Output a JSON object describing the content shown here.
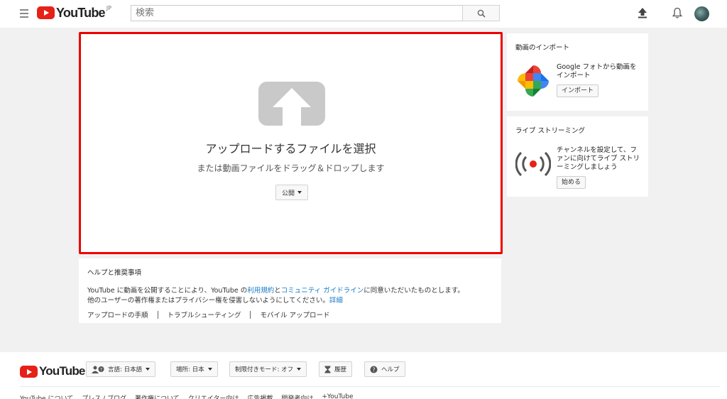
{
  "header": {
    "logo_text": "YouTube",
    "region": "JP",
    "search_placeholder": "検索"
  },
  "upload": {
    "title": "アップロードするファイルを選択",
    "subtitle": "または動画ファイルをドラッグ＆ドロップします",
    "privacy_label": "公開"
  },
  "help": {
    "title": "ヘルプと推奨事項",
    "text_1": "YouTube に動画を公開することにより、YouTube の",
    "link_terms": "利用規約",
    "text_2": "と",
    "link_guidelines": "コミュニティ ガイドライン",
    "text_3": "に同意いただいたものとします。",
    "text_4": "他のユーザーの著作権またはプライバシー権を侵害しないようにしてください。",
    "link_details": "詳細",
    "links": [
      "アップロードの手順",
      "トラブルシューティング",
      "モバイル アップロード"
    ]
  },
  "sidebar": {
    "import": {
      "title": "動画のインポート",
      "body": "Google フォトから動画をインポート",
      "button": "インポート"
    },
    "live": {
      "title": "ライブ ストリーミング",
      "body": "チャンネルを設定して、ファンに向けてライブ ストリーミングしましょう",
      "button": "始める"
    }
  },
  "footer": {
    "logo_text": "YouTube",
    "language": "言語: 日本語",
    "location": "場所: 日本",
    "restricted": "制限付きモード: オフ",
    "history": "履歴",
    "help": "ヘルプ",
    "links": [
      "YouTube について",
      "プレス / ブログ",
      "著作権について",
      "クリエイター向け",
      "広告掲載",
      "開発者向け",
      "+YouTube"
    ]
  },
  "colors": {
    "accent_red": "#e62117",
    "highlight_border": "#ee0000",
    "link_blue": "#167ac6"
  }
}
